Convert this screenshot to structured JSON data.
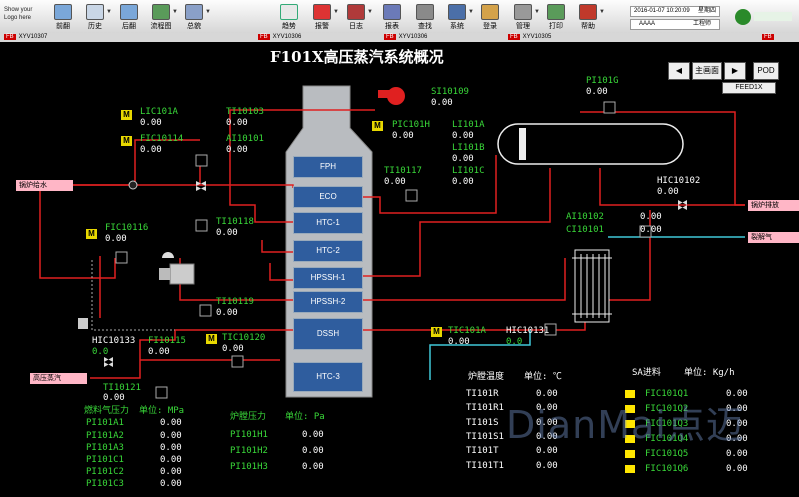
{
  "toolbar": {
    "logo": "Show your Logo here",
    "buttons": [
      "前翻",
      "历史",
      "后翻",
      "流程图",
      "总貌",
      "趋势",
      "报警",
      "日志",
      "报表",
      "查找",
      "系统",
      "登录",
      "管理",
      "打印",
      "帮助"
    ],
    "date": "2016-01-07 10:20:09",
    "weekday": "星期四",
    "user": "AAAA",
    "role": "工程师"
  },
  "alarmbar": [
    {
      "tag": "FB",
      "text": "XYV10307"
    },
    {
      "tag": "FB",
      "text": "XYV10306"
    },
    {
      "tag": "FB",
      "text": "XYV10306"
    },
    {
      "tag": "FB",
      "text": "XYV10305"
    },
    {
      "tag": "FB",
      "text": ""
    }
  ],
  "title": "F101X高压蒸汽系统概况",
  "nav": {
    "main": "主画面",
    "pod": "POD",
    "feed": "FEED1X"
  },
  "furnace_blocks": [
    "FPH",
    "ECO",
    "HTC-1",
    "HTC-2",
    "HPSSH-1",
    "HPSSH-2",
    "DSSH",
    "HTC-3"
  ],
  "points": {
    "lic101a": {
      "name": "LIC101A",
      "val": "0.00"
    },
    "fic10114": {
      "name": "FIC10114",
      "val": "0.00"
    },
    "ti10103": {
      "name": "TI10103",
      "val": "0.00"
    },
    "ai10101": {
      "name": "AI10101",
      "val": "0.00"
    },
    "si10109": {
      "name": "SI10109",
      "val": "0.00"
    },
    "pic101h": {
      "name": "PIC101H",
      "val": "0.00"
    },
    "li101a": {
      "name": "LI101A",
      "val": "0.00"
    },
    "li101b": {
      "name": "LI101B",
      "val": "0.00"
    },
    "li101c": {
      "name": "LI101C",
      "val": "0.00"
    },
    "ti10117": {
      "name": "TI10117",
      "val": "0.00"
    },
    "pi101g": {
      "name": "PI101G",
      "val": "0.00"
    },
    "hic10102": {
      "name": "HIC10102",
      "val": "0.00"
    },
    "ai10102": {
      "name": "AI10102",
      "val": "0.00"
    },
    "ci10101": {
      "name": "CI10101",
      "val": "0.00"
    },
    "fic10116": {
      "name": "FIC10116",
      "val": "0.00"
    },
    "ti10118": {
      "name": "TI10118",
      "val": "0.00"
    },
    "ti10119": {
      "name": "TI10119",
      "val": "0.00"
    },
    "hic10133": {
      "name": "HIC10133",
      "val": "0.0"
    },
    "fi10115": {
      "name": "FI10115",
      "val": "0.00"
    },
    "tic10120": {
      "name": "TIC10120",
      "val": "0.00"
    },
    "ti10121": {
      "name": "TI10121",
      "val": "0.00"
    },
    "tic101a": {
      "name": "TIC101A",
      "val": "0.00"
    },
    "hic10131": {
      "name": "HIC10131",
      "val": "0.0"
    }
  },
  "streams": {
    "boiler_feed": "锅炉给水",
    "hp_steam": "高压蒸汽",
    "blowdown": "锅炉排放",
    "cracking_gas": "裂解气"
  },
  "fuel_gas": {
    "title": "燃料气压力",
    "unit": "单位: MPa",
    "rows": [
      {
        "n": "PI101A1",
        "v": "0.00"
      },
      {
        "n": "PI101A2",
        "v": "0.00"
      },
      {
        "n": "PI101A3",
        "v": "0.00"
      },
      {
        "n": "PI101C1",
        "v": "0.00"
      },
      {
        "n": "PI101C2",
        "v": "0.00"
      },
      {
        "n": "PI101C3",
        "v": "0.00"
      }
    ]
  },
  "furnace_pressure": {
    "title": "炉膛压力",
    "unit": "单位: Pa",
    "rows": [
      {
        "n": "PI101H1",
        "v": "0.00"
      },
      {
        "n": "PI101H2",
        "v": "0.00"
      },
      {
        "n": "PI101H3",
        "v": "0.00"
      }
    ]
  },
  "furnace_temp": {
    "title": "炉膛温度",
    "unit": "单位: ℃",
    "rows": [
      {
        "n": "TI101R",
        "v": "0.00"
      },
      {
        "n": "TI101R1",
        "v": "0.00"
      },
      {
        "n": "TI101S",
        "v": "0.00"
      },
      {
        "n": "TI101S1",
        "v": "0.00"
      },
      {
        "n": "TI101T",
        "v": "0.00"
      },
      {
        "n": "TI101T1",
        "v": "0.00"
      }
    ]
  },
  "sa_feed": {
    "title": "SA进料",
    "unit": "单位: Kg/h",
    "rows": [
      {
        "n": "FIC101Q1",
        "v": "0.00"
      },
      {
        "n": "FIC101Q2",
        "v": "0.00"
      },
      {
        "n": "FIC101Q3",
        "v": "0.00"
      },
      {
        "n": "FIC101Q4",
        "v": "0.00"
      },
      {
        "n": "FIC101Q5",
        "v": "0.00"
      },
      {
        "n": "FIC101Q6",
        "v": "0.00"
      }
    ]
  },
  "m_label": "M",
  "watermark": "DianMai点迈",
  "colors": {
    "pipe_red": "#e02020",
    "pipe_cyan": "#40c8d8",
    "value_green": "#39d839",
    "indicator_yellow": "#ffe600",
    "block_blue": "#2f5d9e"
  }
}
